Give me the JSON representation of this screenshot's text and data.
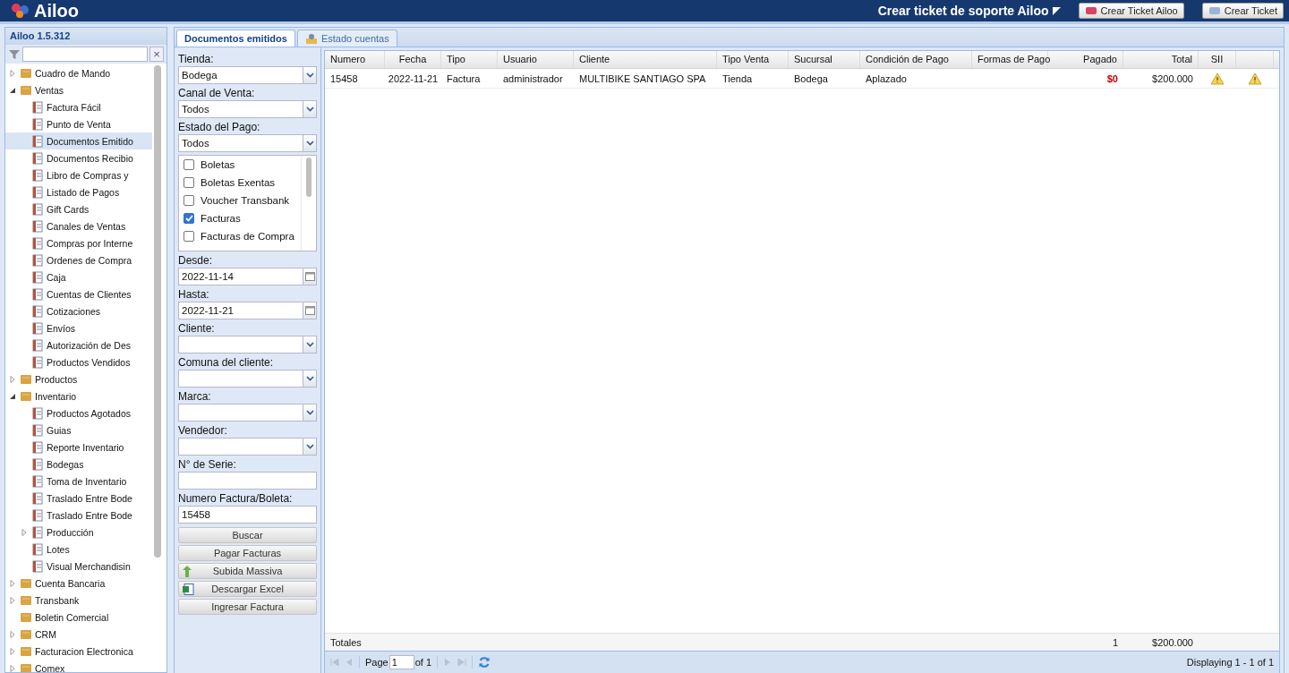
{
  "header": {
    "logo": "Ailoo",
    "support_label": "Crear ticket de soporte Ailoo",
    "buttons": [
      "Crear Ticket Ailoo",
      "Crear Ticket"
    ]
  },
  "sidebar": {
    "title": "Ailoo 1.5.312",
    "filter": {
      "clear": "×"
    },
    "items": [
      {
        "label": "Cuadro de Mando",
        "expanded": false,
        "has_children": true,
        "selected": false
      },
      {
        "label": "Ventas",
        "expanded": true,
        "has_children": true,
        "selected": false,
        "children": [
          {
            "label": "Factura Fácil",
            "selected": false
          },
          {
            "label": "Punto de Venta",
            "selected": false
          },
          {
            "label": "Documentos Emitido",
            "selected": true
          },
          {
            "label": "Documentos Recibio",
            "selected": false
          },
          {
            "label": "Libro de Compras y",
            "selected": false
          },
          {
            "label": "Listado de Pagos",
            "selected": false
          },
          {
            "label": "Gift Cards",
            "selected": false
          },
          {
            "label": "Canales de Ventas",
            "selected": false
          },
          {
            "label": "Compras por Interne",
            "selected": false
          },
          {
            "label": "Ordenes de Compra",
            "selected": false
          },
          {
            "label": "Caja",
            "selected": false
          },
          {
            "label": "Cuentas de Clientes",
            "selected": false
          },
          {
            "label": "Cotizaciones",
            "selected": false
          },
          {
            "label": "Envíos",
            "selected": false
          },
          {
            "label": "Autorización de Des",
            "selected": false
          },
          {
            "label": "Productos Vendidos",
            "selected": false
          }
        ]
      },
      {
        "label": "Productos",
        "expanded": false,
        "has_children": true,
        "selected": false
      },
      {
        "label": "Inventario",
        "expanded": true,
        "has_children": true,
        "selected": false,
        "children": [
          {
            "label": "Productos Agotados",
            "selected": false
          },
          {
            "label": "Guias",
            "selected": false
          },
          {
            "label": "Reporte Inventario",
            "selected": false
          },
          {
            "label": "Bodegas",
            "selected": false
          },
          {
            "label": "Toma de Inventario",
            "selected": false
          },
          {
            "label": "Traslado Entre Bode",
            "selected": false
          },
          {
            "label": "Traslado Entre Bode",
            "selected": false
          },
          {
            "label": "Producción",
            "expanded": false,
            "has_children": true,
            "selected": false
          },
          {
            "label": "Lotes",
            "selected": false
          },
          {
            "label": "Visual Merchandisin",
            "selected": false
          }
        ]
      },
      {
        "label": "Cuenta Bancaria",
        "expanded": false,
        "has_children": true,
        "selected": false
      },
      {
        "label": "Transbank",
        "expanded": false,
        "has_children": true,
        "selected": false
      },
      {
        "label": "Boletin Comercial",
        "has_children": false,
        "selected": false
      },
      {
        "label": "CRM",
        "expanded": false,
        "has_children": true,
        "selected": false
      },
      {
        "label": "Facturacion Electronica",
        "expanded": false,
        "has_children": true,
        "selected": false
      },
      {
        "label": "Comex",
        "expanded": false,
        "has_children": true,
        "selected": false
      }
    ]
  },
  "tabs": [
    {
      "label": "Documentos emitidos",
      "selected": true
    },
    {
      "label": "Estado cuentas",
      "selected": false
    }
  ],
  "filters": [
    {
      "kind": "select",
      "label": "Tienda:",
      "value": "Bodega"
    },
    {
      "kind": "select",
      "label": "Canal de Venta:",
      "value": "Todos"
    },
    {
      "kind": "select",
      "label": "Estado del Pago:",
      "value": "Todos"
    },
    {
      "kind": "checklist",
      "options": [
        {
          "label": "Boletas",
          "checked": false
        },
        {
          "label": "Boletas Exentas",
          "checked": false
        },
        {
          "label": "Voucher Transbank",
          "checked": false
        },
        {
          "label": "Facturas",
          "checked": true
        },
        {
          "label": "Facturas de Compra",
          "checked": false
        }
      ]
    },
    {
      "kind": "date",
      "label": "Desde:",
      "value": "2022-11-14"
    },
    {
      "kind": "date",
      "label": "Hasta:",
      "value": "2022-11-21"
    },
    {
      "kind": "select",
      "label": "Cliente:"
    },
    {
      "kind": "select",
      "label": "Comuna del cliente:"
    },
    {
      "kind": "select",
      "label": "Marca:"
    },
    {
      "kind": "select",
      "label": "Vendedor:"
    },
    {
      "kind": "text",
      "label": "N° de Serie:"
    },
    {
      "kind": "text",
      "label": "Numero Factura/Boleta:",
      "value": "15458"
    }
  ],
  "actions": [
    {
      "label": "Buscar",
      "kind": "plain"
    },
    {
      "label": "Pagar Facturas",
      "kind": "plain"
    },
    {
      "label": "Subida Massiva",
      "kind": "upload"
    },
    {
      "label": "Descargar Excel",
      "kind": "excel"
    },
    {
      "label": "Ingresar Factura",
      "kind": "plain"
    }
  ],
  "table": {
    "columns": [
      "Numero",
      "Fecha",
      "Tipo",
      "Usuario",
      "Cliente",
      "Tipo Venta",
      "Sucursal",
      "Condición de Pago",
      "Formas de Pago",
      "Pagado",
      "Total",
      "SII"
    ],
    "rows": [
      {
        "cells": [
          "15458",
          "2022-11-21",
          "Factura",
          "administrador",
          "MULTIBIKE SANTIAGO SPA",
          "Tienda",
          "Bodega",
          "Aplazado",
          "",
          "$0",
          "$200.000"
        ],
        "paid": false,
        "sii_warning": true,
        "extra_warning": true
      }
    ],
    "totals": {
      "label": "Totales",
      "count": "1",
      "total": "$200.000"
    }
  },
  "pager": {
    "page_label": "Page",
    "page": "1",
    "of": "of 1",
    "displaying": "Displaying 1 - 1 of 1"
  }
}
